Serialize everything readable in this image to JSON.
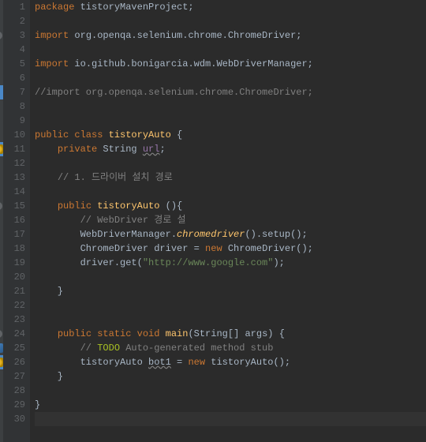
{
  "lines": [
    {
      "n": 1,
      "seg": [
        {
          "c": "kw",
          "t": "package "
        },
        {
          "c": "pkg",
          "t": "tistoryMavenProject;"
        }
      ]
    },
    {
      "n": 2,
      "seg": []
    },
    {
      "n": 3,
      "fold": true,
      "seg": [
        {
          "c": "kw",
          "t": "import "
        },
        {
          "c": "pkg",
          "t": "org.openqa.selenium.chrome.ChromeDriver;"
        }
      ]
    },
    {
      "n": 4,
      "seg": []
    },
    {
      "n": 5,
      "seg": [
        {
          "c": "kw",
          "t": "import "
        },
        {
          "c": "pkg",
          "t": "io.github.bonigarcia.wdm.WebDriverManager;"
        }
      ]
    },
    {
      "n": 6,
      "seg": []
    },
    {
      "n": 7,
      "blue": true,
      "seg": [
        {
          "c": "cmt",
          "t": "//import org.openqa.selenium.chrome.ChromeDriver;"
        }
      ]
    },
    {
      "n": 8,
      "seg": []
    },
    {
      "n": 9,
      "seg": []
    },
    {
      "n": 10,
      "seg": [
        {
          "c": "kw",
          "t": "public class "
        },
        {
          "c": "method",
          "t": "tistoryAuto"
        },
        {
          "c": "",
          "t": " {"
        }
      ]
    },
    {
      "n": 11,
      "blue": true,
      "warn": true,
      "seg": [
        {
          "c": "",
          "t": "    "
        },
        {
          "c": "kw",
          "t": "private "
        },
        {
          "c": "cls",
          "t": "String "
        },
        {
          "c": "field squiggle",
          "t": "url"
        },
        {
          "c": "",
          "t": ";"
        }
      ]
    },
    {
      "n": 12,
      "seg": []
    },
    {
      "n": 13,
      "seg": [
        {
          "c": "",
          "t": "    "
        },
        {
          "c": "cmt",
          "t": "// 1. 드라이버 설치 경로"
        }
      ]
    },
    {
      "n": 14,
      "seg": []
    },
    {
      "n": 15,
      "fold": true,
      "seg": [
        {
          "c": "",
          "t": "    "
        },
        {
          "c": "kw",
          "t": "public "
        },
        {
          "c": "method",
          "t": "tistoryAuto"
        },
        {
          "c": "",
          "t": " (){"
        }
      ]
    },
    {
      "n": 16,
      "seg": [
        {
          "c": "",
          "t": "        "
        },
        {
          "c": "cmt",
          "t": "// WebDriver 경로 설"
        }
      ]
    },
    {
      "n": 17,
      "seg": [
        {
          "c": "",
          "t": "        "
        },
        {
          "c": "cls",
          "t": "WebDriverManager."
        },
        {
          "c": "static-method",
          "t": "chromedriver"
        },
        {
          "c": "",
          "t": "().setup();"
        }
      ]
    },
    {
      "n": 18,
      "seg": [
        {
          "c": "",
          "t": "        "
        },
        {
          "c": "cls",
          "t": "ChromeDriver "
        },
        {
          "c": "",
          "t": "driver = "
        },
        {
          "c": "kw",
          "t": "new "
        },
        {
          "c": "cls",
          "t": "ChromeDriver();"
        }
      ]
    },
    {
      "n": 19,
      "seg": [
        {
          "c": "",
          "t": "        "
        },
        {
          "c": "",
          "t": "driver.get("
        },
        {
          "c": "str",
          "t": "\"http://www.google.com\""
        },
        {
          "c": "",
          "t": ");"
        }
      ]
    },
    {
      "n": 20,
      "seg": []
    },
    {
      "n": 21,
      "seg": [
        {
          "c": "",
          "t": "    }"
        }
      ]
    },
    {
      "n": 22,
      "seg": []
    },
    {
      "n": 23,
      "seg": []
    },
    {
      "n": 24,
      "fold": true,
      "seg": [
        {
          "c": "",
          "t": "    "
        },
        {
          "c": "kw",
          "t": "public static void "
        },
        {
          "c": "method",
          "t": "main"
        },
        {
          "c": "",
          "t": "("
        },
        {
          "c": "cls",
          "t": "String"
        },
        {
          "c": "",
          "t": "[] "
        },
        {
          "c": "",
          "t": "args) {"
        }
      ]
    },
    {
      "n": 25,
      "task": true,
      "seg": [
        {
          "c": "",
          "t": "        "
        },
        {
          "c": "cmt",
          "t": "// "
        },
        {
          "c": "todo",
          "t": "TODO"
        },
        {
          "c": "cmt",
          "t": " Auto-generated method stub"
        }
      ]
    },
    {
      "n": 26,
      "blue": true,
      "warn": true,
      "seg": [
        {
          "c": "",
          "t": "        "
        },
        {
          "c": "cls",
          "t": "tistoryAuto "
        },
        {
          "c": "squiggle",
          "t": "bot1"
        },
        {
          "c": "",
          "t": " = "
        },
        {
          "c": "kw",
          "t": "new "
        },
        {
          "c": "cls",
          "t": "tistoryAuto();"
        }
      ]
    },
    {
      "n": 27,
      "seg": [
        {
          "c": "",
          "t": "    }"
        }
      ]
    },
    {
      "n": 28,
      "seg": []
    },
    {
      "n": 29,
      "seg": [
        {
          "c": "",
          "t": "}"
        }
      ]
    },
    {
      "n": 30,
      "current": true,
      "seg": []
    }
  ]
}
